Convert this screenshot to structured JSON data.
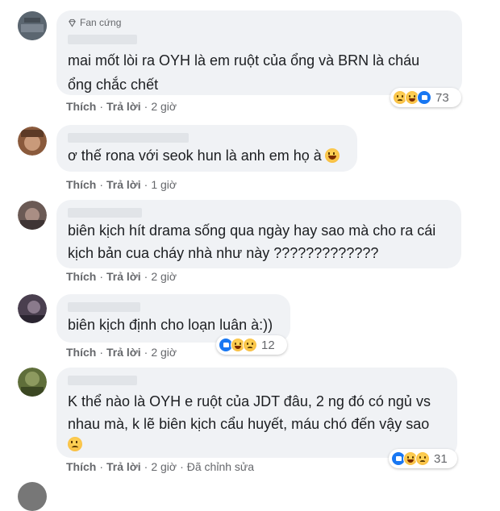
{
  "comments": [
    {
      "badge": "Fan cứng",
      "lines": [
        "mai mốt lòi ra OYH là em ruột của ổng và BRN là cháu",
        "ổng chắc chết"
      ],
      "actions": {
        "like": "Thích",
        "reply": "Trả lời",
        "time": "2 giờ"
      },
      "reactions": {
        "icons": [
          "sad-icon",
          "haha-icon",
          "like-icon"
        ],
        "count": "73"
      },
      "avatar_color": "#5b6670"
    },
    {
      "lines": [
        "ơ thế rona với seok hun là anh em họ à"
      ],
      "inline_emoji": "grin-icon",
      "actions": {
        "like": "Thích",
        "reply": "Trả lời",
        "time": "1 giờ"
      },
      "avatar_color": "#8a5a3c"
    },
    {
      "lines": [
        "biên kịch hít drama sống qua ngày hay sao mà cho ra cái",
        "kịch bản cua cháy nhà như này ?????????????"
      ],
      "actions": {
        "like": "Thích",
        "reply": "Trả lời",
        "time": "2 giờ"
      },
      "avatar_color": "#6b5a55"
    },
    {
      "lines": [
        "biên kịch định cho loạn luân à:))"
      ],
      "actions": {
        "like": "Thích",
        "reply": "Trả lời",
        "time": "2 giờ"
      },
      "reactions": {
        "icons": [
          "like-icon",
          "haha-icon",
          "sad-icon"
        ],
        "count": "12"
      },
      "avatar_color": "#4a3f4f"
    },
    {
      "lines": [
        "K thể nào là OYH e ruột của JDT đâu, 2 ng đó có ngủ vs",
        "nhau mà, k lẽ biên kịch cẩu huyết, máu chó đến vậy sao"
      ],
      "inline_emoji": "sad-icon",
      "actions": {
        "like": "Thích",
        "reply": "Trả lời",
        "time": "2 giờ",
        "edited": "Đã chỉnh sửa"
      },
      "reactions": {
        "icons": [
          "like-icon",
          "haha-icon",
          "sad-icon"
        ],
        "count": "31"
      },
      "avatar_color": "#5f6e3a"
    }
  ],
  "colors": {
    "bubble": "#f0f2f5",
    "meta": "#65676b",
    "like_blue": "#1877f2"
  }
}
